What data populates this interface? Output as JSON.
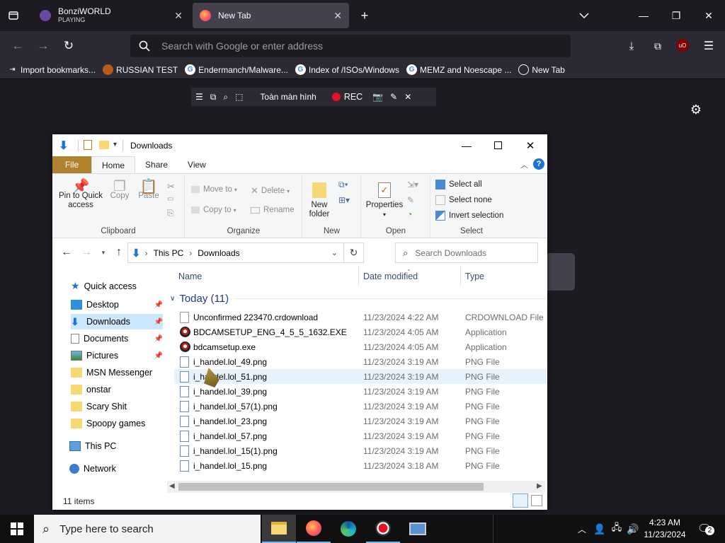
{
  "browser": {
    "tabs": [
      {
        "title": "BonziWORLD",
        "subtitle": "PLAYING"
      },
      {
        "title": "New Tab"
      }
    ],
    "url_placeholder": "Search with Google or enter address",
    "bookmarks": [
      "Import bookmarks...",
      "RUSSIAN TEST",
      "Endermanch/Malware...",
      "Index of /ISOs/Windows",
      "MEMZ and Noescape ...",
      "New Tab"
    ]
  },
  "recorder": {
    "fullscreen_label": "Toàn màn hình",
    "rec_label": "REC"
  },
  "explorer": {
    "title": "Downloads",
    "ribbon_tabs": [
      "File",
      "Home",
      "Share",
      "View"
    ],
    "clipboard": {
      "pin": "Pin to Quick access",
      "copy": "Copy",
      "paste": "Paste",
      "label": "Clipboard"
    },
    "organize": {
      "move_to": "Move to",
      "copy_to": "Copy to",
      "delete": "Delete",
      "rename": "Rename",
      "label": "Organize"
    },
    "new": {
      "new_folder": "New folder",
      "label": "New"
    },
    "open": {
      "properties": "Properties",
      "label": "Open"
    },
    "select": {
      "select_all": "Select all",
      "select_none": "Select none",
      "invert": "Invert selection",
      "label": "Select"
    },
    "breadcrumb": [
      "This PC",
      "Downloads"
    ],
    "search_placeholder": "Search Downloads",
    "nav": {
      "quick_access": "Quick access",
      "items": [
        "Desktop",
        "Downloads",
        "Documents",
        "Pictures",
        "MSN Messenger",
        "onstar",
        "Scary Shit",
        "Spoopy games"
      ],
      "this_pc": "This PC",
      "network": "Network"
    },
    "columns": {
      "name": "Name",
      "date": "Date modified",
      "type": "Type"
    },
    "group_header": "Today (11)",
    "files": [
      {
        "name": "Unconfirmed 223470.crdownload",
        "date": "11/23/2024 4:22 AM",
        "type": "CRDOWNLOAD File"
      },
      {
        "name": "BDCAMSETUP_ENG_4_5_5_1632.EXE",
        "date": "11/23/2024 4:05 AM",
        "type": "Application"
      },
      {
        "name": "bdcamsetup.exe",
        "date": "11/23/2024 4:05 AM",
        "type": "Application"
      },
      {
        "name": "i_handel.lol_49.png",
        "date": "11/23/2024 3:19 AM",
        "type": "PNG File"
      },
      {
        "name": "i_handel.lol_51.png",
        "date": "11/23/2024 3:19 AM",
        "type": "PNG File"
      },
      {
        "name": "i_handel.lol_39.png",
        "date": "11/23/2024 3:19 AM",
        "type": "PNG File"
      },
      {
        "name": "i_handel.lol_57(1).png",
        "date": "11/23/2024 3:19 AM",
        "type": "PNG File"
      },
      {
        "name": "i_handel.lol_23.png",
        "date": "11/23/2024 3:19 AM",
        "type": "PNG File"
      },
      {
        "name": "i_handel.lol_57.png",
        "date": "11/23/2024 3:19 AM",
        "type": "PNG File"
      },
      {
        "name": "i_handel.lol_15(1).png",
        "date": "11/23/2024 3:19 AM",
        "type": "PNG File"
      },
      {
        "name": "i_handel.lol_15.png",
        "date": "11/23/2024 3:18 AM",
        "type": "PNG File"
      }
    ],
    "status": "11 items"
  },
  "taskbar": {
    "search_placeholder": "Type here to search",
    "time": "4:23 AM",
    "date": "11/23/2024",
    "notification_count": "2"
  }
}
